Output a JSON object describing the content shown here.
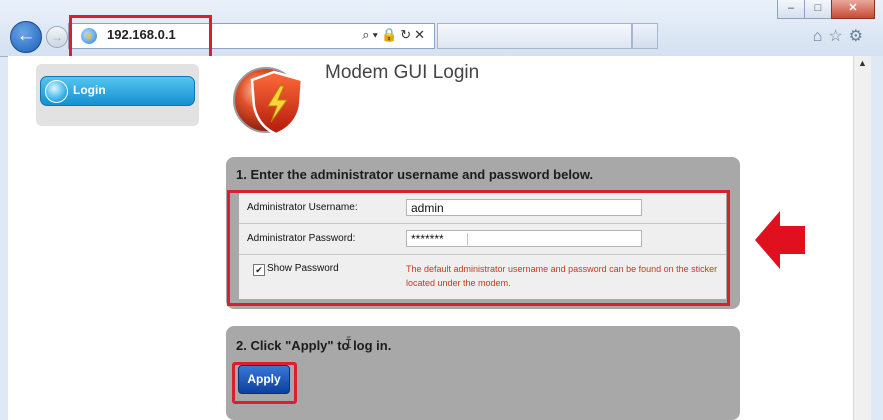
{
  "browser": {
    "url": "192.168.0.1",
    "window_buttons": [
      "–",
      "□",
      "✕"
    ],
    "nav_icons": [
      "back-arrow-icon",
      "forward-arrow-icon"
    ],
    "address_tools": "⌕▾🔒↻✕",
    "toolbar_icons": [
      "home-icon",
      "favorites-star-icon",
      "settings-gear-icon"
    ]
  },
  "sidebar": {
    "items": [
      {
        "label": "Login",
        "active": true
      }
    ]
  },
  "header": {
    "title": "Modem GUI Login"
  },
  "step1": {
    "heading": "1. Enter the administrator username and password below.",
    "username_label": "Administrator Username:",
    "username_value": "admin",
    "password_label": "Administrator Password:",
    "password_value": "*******",
    "show_password_label": "Show Password",
    "show_password_checked": true,
    "note": "The default administrator username and password can be found on the sticker located under the modem."
  },
  "step2": {
    "heading": "2. Click \"Apply\" to log in.",
    "apply_label": "Apply"
  },
  "colors": {
    "highlight": "#d8202f",
    "note_text": "#c33a20",
    "panel_bg": "#a8a8a8",
    "login_tab": "#1590d0",
    "apply_button": "#0c3fa0"
  }
}
